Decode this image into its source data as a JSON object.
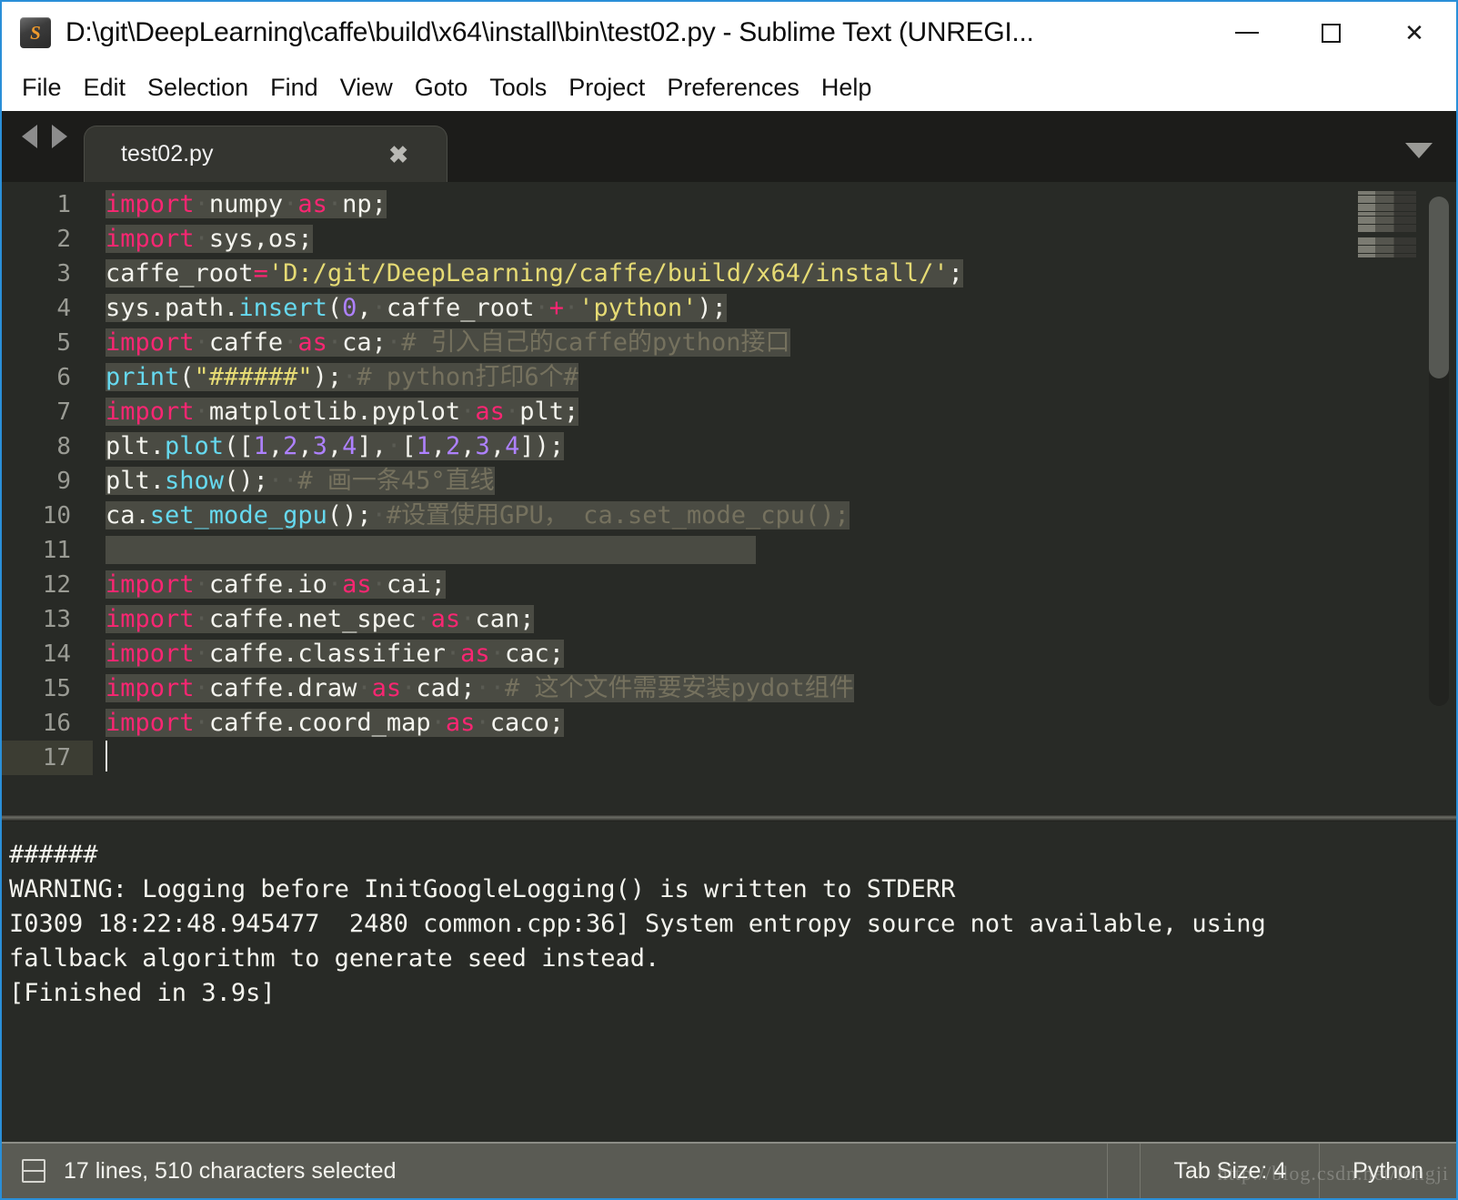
{
  "window": {
    "title": "D:\\git\\DeepLearning\\caffe\\build\\x64\\install\\bin\\test02.py - Sublime Text (UNREGI...",
    "icon_letter": "S",
    "minimize_label": "−",
    "maximize_label": "□",
    "close_label": "✕"
  },
  "menubar": {
    "items": [
      {
        "label": "File"
      },
      {
        "label": "Edit"
      },
      {
        "label": "Selection"
      },
      {
        "label": "Find"
      },
      {
        "label": "View"
      },
      {
        "label": "Goto"
      },
      {
        "label": "Tools"
      },
      {
        "label": "Project"
      },
      {
        "label": "Preferences"
      },
      {
        "label": "Help"
      }
    ]
  },
  "tabbar": {
    "tabs": [
      {
        "label": "test02.py",
        "close": "✖"
      }
    ],
    "dropdown_label": "▼"
  },
  "editor": {
    "active_line": 17,
    "line_numbers": [
      "1",
      "2",
      "3",
      "4",
      "5",
      "6",
      "7",
      "8",
      "9",
      "10",
      "11",
      "12",
      "13",
      "14",
      "15",
      "16",
      "17"
    ],
    "lines": [
      "import numpy as np;",
      "import sys,os;",
      "caffe_root='D:/git/DeepLearning/caffe/build/x64/install/';",
      "sys.path.insert(0, caffe_root + 'python');",
      "import caffe as ca; # 引入自己的caffe的python接口",
      "print(\"######\"); # python打印6个#",
      "import matplotlib.pyplot as plt;",
      "plt.plot([1,2,3,4], [1,2,3,4]);",
      "plt.show();  # 画一條45°直线",
      "ca.set_mode_gpu(); #设置使用GPU， ca.set_mode_cpu();",
      "",
      "import caffe.io as cai;",
      "import caffe.net_spec as can;",
      "import caffe.classifier as cac;",
      "import caffe.draw as cad; # 这个文件需要安装pydot组件",
      "import caffe.coord_map as caco;",
      ""
    ]
  },
  "console": {
    "lines": [
      "######",
      "WARNING: Logging before InitGoogleLogging() is written to STDERR",
      "I0309 18:22:48.945477  2480 common.cpp:36] System entropy source not available, using",
      "fallback algorithm to generate seed instead.",
      "[Finished in 3.9s]"
    ]
  },
  "statusbar": {
    "selection_text": "17 lines, 510 characters selected",
    "tab_size": "Tab Size: 4",
    "syntax": "Python",
    "watermark": "http://blog.csdn.net/longji"
  },
  "colors": {
    "editor_bg": "#282a26",
    "selection": "#4a4b43",
    "keyword": "#f92672",
    "function": "#66d9ef",
    "string": "#e6db74",
    "number": "#ae81ff",
    "comment": "#75715e",
    "accent_border": "#2a8fd8",
    "statusbar_bg": "#5a5b54",
    "tabbar_bg": "#1c1c1a",
    "tab_active_bg": "#343530"
  }
}
